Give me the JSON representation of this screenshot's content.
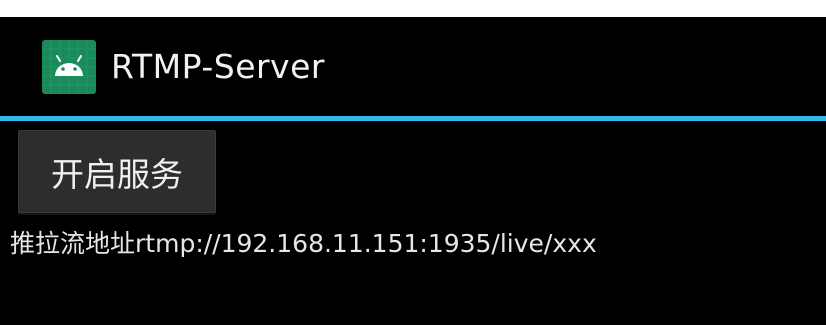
{
  "app_bar": {
    "title": "RTMP-Server",
    "icon": "android-icon",
    "icon_color": "#3ddc84",
    "accent_color": "#33b5e5"
  },
  "main": {
    "start_service_label": "开启服务",
    "address_label": "推拉流地址",
    "address_url": "rtmp://192.168.11.151:1935/live/xxx"
  }
}
